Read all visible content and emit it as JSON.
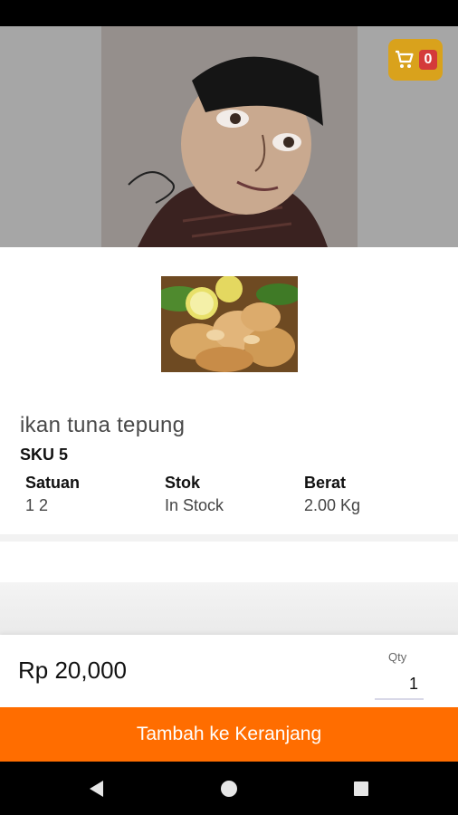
{
  "header": {
    "cart_count": "0",
    "cart_icon": "cart-icon"
  },
  "product": {
    "name": "ikan tuna tepung",
    "sku": "SKU 5",
    "specs": [
      {
        "label": "Satuan",
        "value": "1 2"
      },
      {
        "label": "Stok",
        "value": "In Stock"
      },
      {
        "label": "Berat",
        "value": "2.00 Kg"
      }
    ]
  },
  "purchase": {
    "price": "Rp 20,000",
    "qty_label": "Qty",
    "qty_value": "1",
    "add_button_label": "Tambah ke Keranjang"
  },
  "navigation": {
    "icons": [
      "back-icon",
      "home-icon",
      "recents-icon"
    ]
  },
  "colors": {
    "accent": "#ff6d00",
    "cart_button": "#d9a21c",
    "badge": "#d43a3a"
  }
}
